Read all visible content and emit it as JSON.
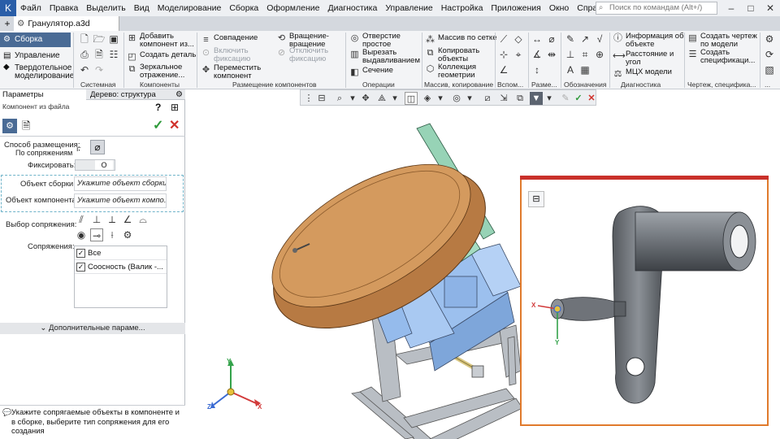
{
  "menubar": {
    "items": [
      "Файл",
      "Правка",
      "Выделить",
      "Вид",
      "Моделирование",
      "Сборка",
      "Оформление",
      "Диагностика",
      "Управление",
      "Настройка",
      "Приложения",
      "Окно",
      "Справка"
    ],
    "search_placeholder": "Поиск по командам (Alt+/)"
  },
  "tabs": {
    "doc": "Гранулятор.a3d"
  },
  "ribbon": {
    "modes": [
      "Сборка",
      "Управление",
      "Твердотельное моделирование"
    ],
    "buttons": {
      "add_component": "Добавить компонент из...",
      "create_part": "Создать деталь",
      "mirror_component": "Зеркальное отражение...",
      "coincide": "Совпадение",
      "enable_fix": "Включить фиксацию",
      "move_component": "Переместить компонент",
      "rotate": "Вращение-вращение",
      "disable_fix": "Отключить фиксацию",
      "simple_hole": "Отверстие простое",
      "extrude_cut": "Вырезать выдавливанием",
      "section": "Сечение",
      "grid_array": "Массив по сетке",
      "copy_objects": "Копировать объекты",
      "geometry_collection": "Коллекция геометрии",
      "object_info": "Информация об объекте",
      "distance_angle": "Расстояние и угол",
      "mcx_model": "МЦХ модели",
      "create_drawing": "Создать чертеж по модели",
      "create_spec": "Создать спецификаци..."
    },
    "groups": [
      "Системная",
      "Компоненты",
      "Размещение компонентов",
      "Операции",
      "Массив, копирование",
      "Вспом...",
      "Разме...",
      "Обозначения",
      "Диагностика",
      "Чертеж, специфика...",
      "..."
    ]
  },
  "panel": {
    "tabs": [
      "Параметры",
      "Дерево: структура"
    ],
    "title": "Компонент из файла",
    "placement_label": "Способ размещения:",
    "placement_value": "По сопряжениям",
    "fix_label": "Фиксировать:",
    "toggle_value": "O",
    "assembly_object_label": "Объект сборки:",
    "assembly_object_placeholder": "Укажите объект сборки",
    "component_object_label": "Объект компонента:",
    "component_object_placeholder": "Укажите объект компо...",
    "mate_choice_label": "Выбор сопряжения:",
    "mates_label": "Сопряжения:",
    "mates_list": [
      "Все",
      "Соосность (Валик  -..."
    ],
    "more_params": "Дополнительные параме...",
    "hint": "Укажите сопрягаемые объекты в компоненте и в сборке, выберите тип сопряжения для его создания"
  },
  "axes": {
    "x": "X",
    "y": "Y",
    "z": "Z"
  },
  "colors": {
    "accent": "#4a6b95",
    "disc": "#c98a4c",
    "frame": "#b9bec4",
    "mechanism": "#9cc0ee",
    "arm": "#97d3b6",
    "preview_border": "#e07a2c",
    "ok": "#2e9a3a",
    "cancel": "#d0302a"
  }
}
